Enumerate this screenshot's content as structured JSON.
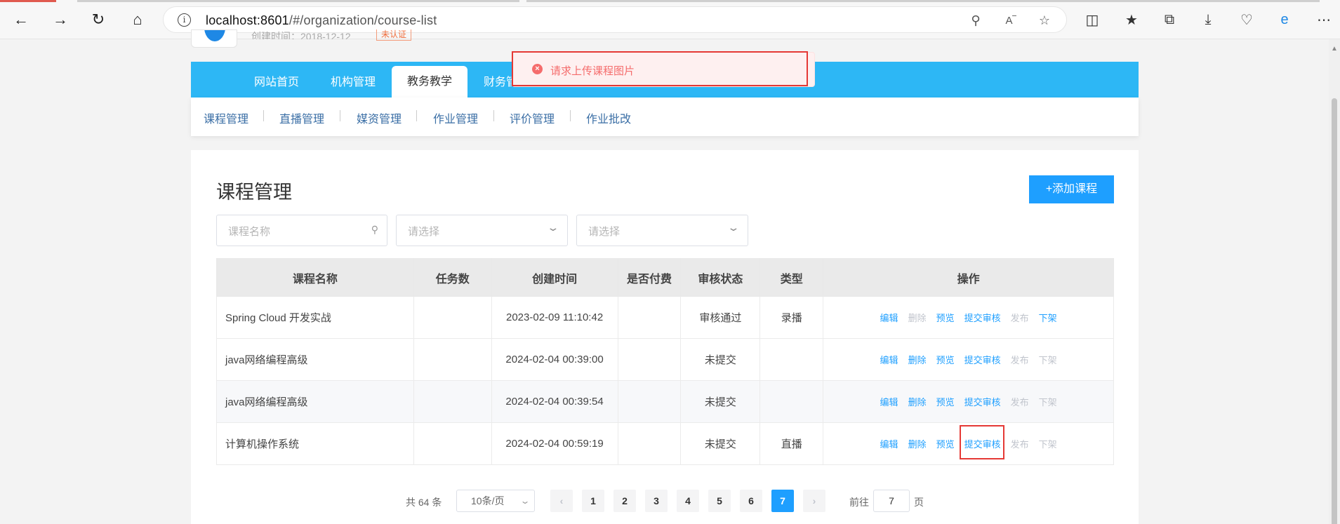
{
  "browser": {
    "url_host": "localhost:8601",
    "url_path": "/#/organization/course-list"
  },
  "profile": {
    "meta": "创建时间：2018-12-12",
    "badge": "未认证"
  },
  "topnav": [
    "网站首页",
    "机构管理",
    "教务教学",
    "财务管理"
  ],
  "subnav": [
    "课程管理",
    "直播管理",
    "媒资管理",
    "作业管理",
    "评价管理",
    "作业批改"
  ],
  "toast": {
    "message": "请求上传课程图片"
  },
  "page": {
    "title": "课程管理",
    "add_button": "+添加课程",
    "search_placeholder": "课程名称",
    "select1_placeholder": "请选择",
    "select2_placeholder": "请选择"
  },
  "table": {
    "headers": [
      "课程名称",
      "任务数",
      "创建时间",
      "是否付费",
      "审核状态",
      "类型",
      "操作"
    ],
    "rows": [
      {
        "name": "Spring Cloud 开发实战",
        "tasks": "",
        "created": "2023-02-09 11:10:42",
        "paid": "",
        "status": "审核通过",
        "type": "录播"
      },
      {
        "name": "java网络编程高级",
        "tasks": "",
        "created": "2024-02-04 00:39:00",
        "paid": "",
        "status": "未提交",
        "type": ""
      },
      {
        "name": "java网络编程高级",
        "tasks": "",
        "created": "2024-02-04 00:39:54",
        "paid": "",
        "status": "未提交",
        "type": ""
      },
      {
        "name": "计算机操作系统",
        "tasks": "",
        "created": "2024-02-04 00:59:19",
        "paid": "",
        "status": "未提交",
        "type": "直播"
      }
    ],
    "ops": [
      "编辑",
      "删除",
      "预览",
      "提交审核",
      "发布",
      "下架"
    ]
  },
  "pager": {
    "total": "共 64 条",
    "size": "10条/页",
    "pages": [
      "1",
      "2",
      "3",
      "4",
      "5",
      "6",
      "7"
    ],
    "current": "7",
    "goto_label": "前往",
    "goto_value": "7",
    "goto_suffix": "页"
  }
}
